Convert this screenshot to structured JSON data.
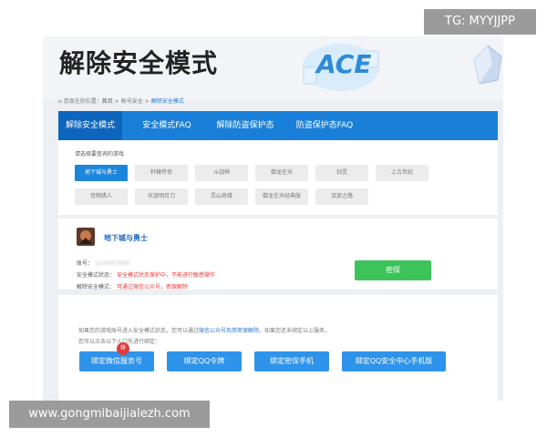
{
  "banner": {
    "title": "解除安全模式",
    "logo_text": "ACE"
  },
  "breadcrumb": {
    "prefix": "您现在的位置：",
    "home": "首页",
    "section": "帐号安全",
    "current": "解除安全模式",
    "sep": ">"
  },
  "nav": {
    "tabs": [
      {
        "label": "解除安全模式",
        "active": true
      },
      {
        "label": "安全模式FAQ",
        "active": false
      },
      {
        "label": "解除防盗保护态",
        "active": false
      },
      {
        "label": "防盗保护态FAQ",
        "active": false
      }
    ]
  },
  "games": {
    "label": "请选择要查询的游戏",
    "items": [
      {
        "label": "地下城与勇士",
        "selected": true
      },
      {
        "label": "轩辕传奇",
        "selected": false
      },
      {
        "label": "斗战神",
        "selected": false
      },
      {
        "label": "御龙在天",
        "selected": false
      },
      {
        "label": "剑灵",
        "selected": false
      },
      {
        "label": "上古世纪",
        "selected": false
      },
      {
        "label": "怪物猎人",
        "selected": false
      },
      {
        "label": "天涯明月刀",
        "selected": false
      },
      {
        "label": "灵山奇缘",
        "selected": false
      },
      {
        "label": "御龙在天经典版",
        "selected": false
      },
      {
        "label": "流放之路",
        "selected": false
      }
    ]
  },
  "status": {
    "game_name": "地下城与勇士",
    "account_label": "账号：",
    "account_value": "1234567890",
    "mode_label": "安全模式状态：",
    "mode_value": "安全模式状态保护中，不能进行敏感操作",
    "unlock_label": "解除安全模式：",
    "unlock_value": "可通过微信公众号，密保解除",
    "button_label": "密保"
  },
  "help": {
    "line1_pre": "如果您的游戏账号进入安全模式状态，您可以通过",
    "line1_link": "微信公众号及简密保解除",
    "line1_post": "。如果您还未绑定以上服务，",
    "line2": "您可以点击以下入口先进行绑定："
  },
  "bind": {
    "badge": "荐",
    "buttons": [
      "绑定微信服务号",
      "绑定QQ令牌",
      "绑定密保手机",
      "绑定QQ安全中心手机版"
    ]
  },
  "watermarks": {
    "top_right": "TG: MYYJJPP",
    "bottom_left": "www.gongmibaijialezh.com"
  }
}
